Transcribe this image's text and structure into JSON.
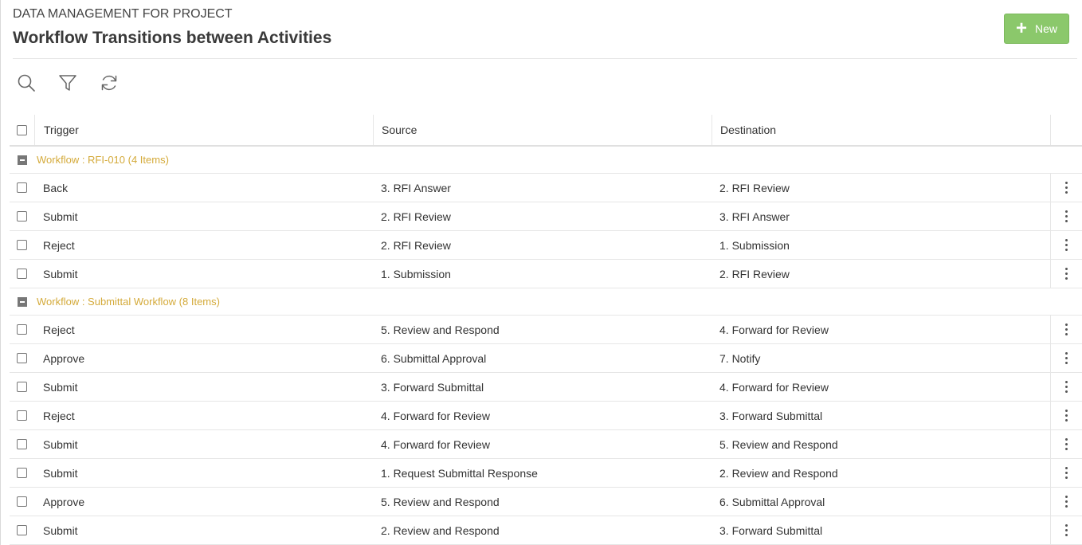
{
  "header": {
    "subtitle": "DATA MANAGEMENT FOR PROJECT",
    "title": "Workflow Transitions between Activities",
    "new_label": "New",
    "accent_color": "#8bc86b"
  },
  "toolbar": {
    "icons": [
      "search-icon",
      "filter-icon",
      "refresh-icon"
    ]
  },
  "table": {
    "columns": [
      "Trigger",
      "Source",
      "Destination"
    ],
    "groups": [
      {
        "label": "Workflow : RFI-010 (4 Items)",
        "rows": [
          {
            "trigger": "Back",
            "source": "3. RFI Answer",
            "destination": "2. RFI Review"
          },
          {
            "trigger": "Submit",
            "source": "2. RFI Review",
            "destination": "3. RFI Answer"
          },
          {
            "trigger": "Reject",
            "source": "2. RFI Review",
            "destination": "1. Submission"
          },
          {
            "trigger": "Submit",
            "source": "1. Submission",
            "destination": "2. RFI Review"
          }
        ]
      },
      {
        "label": "Workflow : Submittal Workflow (8 Items)",
        "rows": [
          {
            "trigger": "Reject",
            "source": "5. Review and Respond",
            "destination": "4. Forward for Review"
          },
          {
            "trigger": "Approve",
            "source": "6. Submittal Approval",
            "destination": "7. Notify"
          },
          {
            "trigger": "Submit",
            "source": "3. Forward Submittal",
            "destination": "4. Forward for Review"
          },
          {
            "trigger": "Reject",
            "source": "4. Forward for Review",
            "destination": "3. Forward Submittal"
          },
          {
            "trigger": "Submit",
            "source": "4. Forward for Review",
            "destination": "5. Review and Respond"
          },
          {
            "trigger": "Submit",
            "source": "1. Request Submittal Response",
            "destination": "2. Review and Respond"
          },
          {
            "trigger": "Approve",
            "source": "5. Review and Respond",
            "destination": "6. Submittal Approval"
          },
          {
            "trigger": "Submit",
            "source": "2. Review and Respond",
            "destination": "3. Forward Submittal"
          }
        ]
      }
    ]
  }
}
